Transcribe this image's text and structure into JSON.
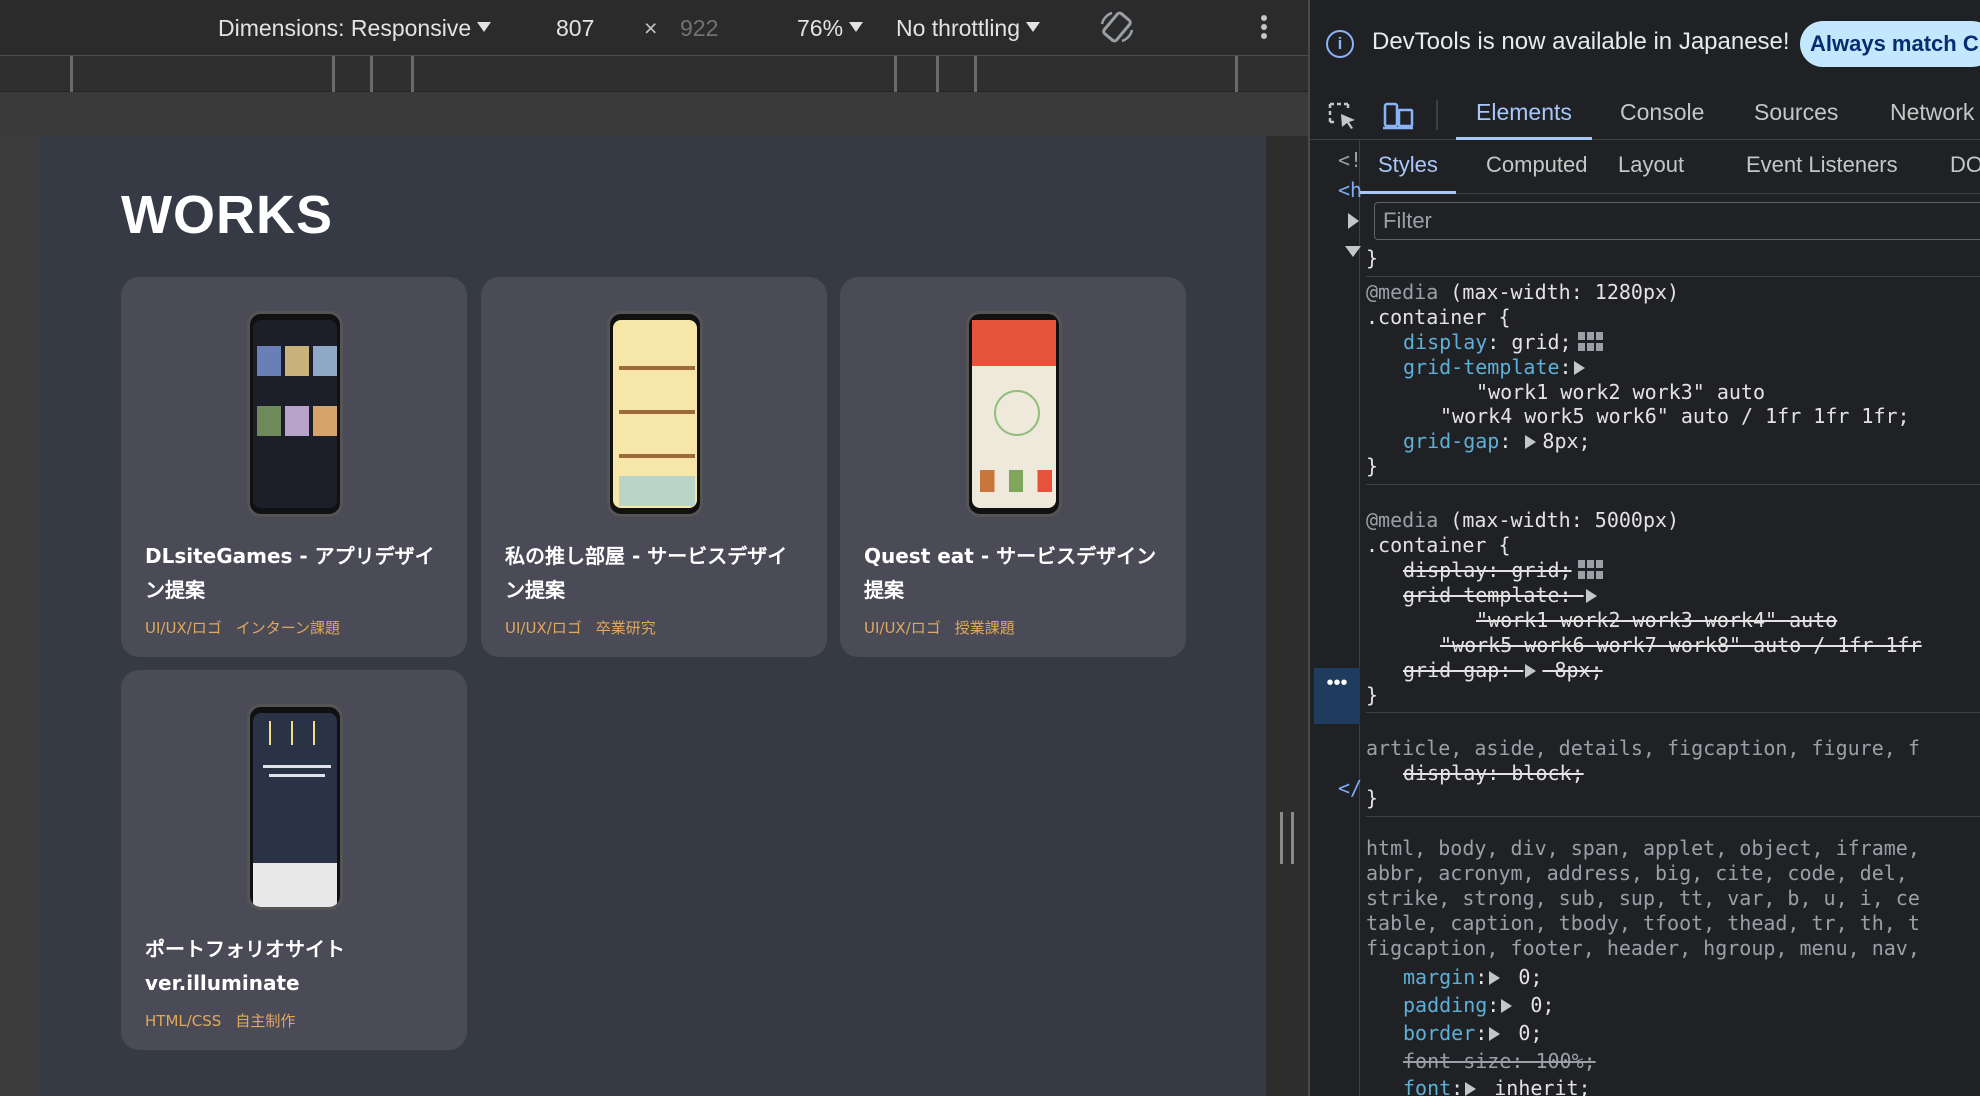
{
  "toolbar": {
    "dimensions_label": "Dimensions: Responsive",
    "width": "807",
    "times": "×",
    "height": "922",
    "zoom": "76%",
    "throttling": "No throttling",
    "rotate_icon": "rotate-icon",
    "more_icon": "more-vertical-icon"
  },
  "page": {
    "works_title": "WORKS",
    "cards": [
      {
        "title": "DLsiteGames - アプリデザイン提案",
        "tags": [
          "UI/UX/ロゴ",
          "インターン課題"
        ],
        "screen_color": "#1c1f2a"
      },
      {
        "title": "私の推し部屋 - サービスデザイン提案",
        "tags": [
          "UI/UX/ロゴ",
          "卒業研究"
        ],
        "screen_color": "#f6e7a8"
      },
      {
        "title": "Quest eat - サービスデザイン提案",
        "tags": [
          "UI/UX/ロゴ",
          "授業課題"
        ],
        "screen_color": "#efe9dc"
      },
      {
        "title": "ポートフォリオサイト ver.illuminate",
        "tags": [
          "HTML/CSS",
          "自主制作"
        ],
        "screen_color": "#2a3346"
      }
    ]
  },
  "devtools": {
    "notice": "DevTools is now available in Japanese!",
    "always_match": "Always match C",
    "tabs": [
      "Elements",
      "Console",
      "Sources",
      "Network"
    ],
    "active_tab": "Elements",
    "sub_tabs": [
      "Styles",
      "Computed",
      "Layout",
      "Event Listeners",
      "DO"
    ],
    "active_sub_tab": "Styles",
    "filter_placeholder": "Filter",
    "dom_gutter": [
      "<!",
      "<h",
      "</"
    ],
    "dots": "•••",
    "rules": {
      "close0": "}",
      "r1_at": "@media",
      "r1_query": " (max-width: 1280px)",
      "r1_sel": ".container {",
      "r1_p1_name": "display",
      "r1_p1_val": ": grid;",
      "r1_p2_name": "grid-template",
      "r1_p2_val": ":",
      "r1_p2_l1": "\"work1 work2 work3\" auto",
      "r1_p2_l2": "\"work4 work5 work6\" auto / 1fr 1fr 1fr;",
      "r1_p3_name": "grid-gap",
      "r1_p3_val": ": ",
      "r1_p3_v": "8px;",
      "r1_close": "}",
      "r2_at": "@media",
      "r2_query": " (max-width: 5000px)",
      "r2_sel": ".container {",
      "r2_p1": "display: grid;",
      "r2_p2": "grid-template: ",
      "r2_p2_l1": "\"work1 work2 work3 work4\" auto",
      "r2_p2_l2": "\"work5 work6 work7 work8\" auto / 1fr 1fr",
      "r2_p3a": "grid-gap: ",
      "r2_p3b": " 8px;",
      "r2_close": "}",
      "r3_sel": "article, aside, details, figcaption, figure, f",
      "r3_p1": "display: block;",
      "r3_close": "}",
      "r4_l1": "html, body, div, span, applet, object, iframe,",
      "r4_l2": "abbr, acronym, address, big, cite, code, del,",
      "r4_l3": "strike, strong, sub, sup, tt, var, b, u, i, ce",
      "r4_l4": "table, caption, tbody, tfoot, thead, tr, th, t",
      "r4_l5": "figcaption, footer, header, hgroup, menu, nav,",
      "r4_p1_name": "margin",
      "r4_p1_val": " 0;",
      "r4_p2_name": "padding",
      "r4_p2_val": " 0;",
      "r4_p3_name": "border",
      "r4_p3_val": " 0;",
      "r4_p4": "font-size: 100%;",
      "r4_p5_name": "font",
      "r4_p5_val": " inherit;"
    }
  }
}
